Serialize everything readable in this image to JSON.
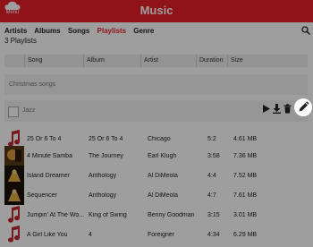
{
  "app": {
    "title": "Music",
    "menu_label": "Menu"
  },
  "tabs": [
    {
      "label": "Artists"
    },
    {
      "label": "Albums"
    },
    {
      "label": "Songs"
    },
    {
      "label": "Playlists",
      "active": true
    },
    {
      "label": "Genre"
    }
  ],
  "playlist_count": "3 Playlists",
  "columns": {
    "song": "Song",
    "album": "Album",
    "artist": "Artist",
    "duration": "Duration",
    "size": "Size"
  },
  "playlists": [
    {
      "name": "Christmas songs"
    },
    {
      "name": "Jazz",
      "actions": [
        "play-icon",
        "download-icon",
        "trash-icon",
        "pencil-icon"
      ]
    }
  ],
  "songs": [
    {
      "title": "25 Or 6 To 4",
      "album": "25 Or 6 To 4",
      "artist": "Chicago",
      "duration": "5:2",
      "size": "4.61 MB",
      "thumb": "music-note-icon"
    },
    {
      "title": "4 Minute Samba",
      "album": "The Journey",
      "artist": "Earl Klugh",
      "duration": "3:58",
      "size": "7.36 MB",
      "thumb": "album-art"
    },
    {
      "title": "Island Dreamer",
      "album": "Anthology",
      "artist": "Al DiMeola",
      "duration": "4:4",
      "size": "7.52 MB",
      "thumb": "album-art"
    },
    {
      "title": "Sequencer",
      "album": "Anthology",
      "artist": "Al DiMeola",
      "duration": "4:7",
      "size": "7.61 MB",
      "thumb": "album-art"
    },
    {
      "title": "Jumpin' At The Wo...",
      "album": "King of Swing",
      "artist": "Benny Goodman",
      "duration": "3:15",
      "size": "3.01 MB",
      "thumb": "music-note-icon"
    },
    {
      "title": "A Girl Like You",
      "album": "4",
      "artist": "Foreigner",
      "duration": "4:34",
      "size": "6.29 MB",
      "thumb": "music-note-icon"
    }
  ],
  "colors": {
    "brand": "#e8202a",
    "overlay": "rgba(0,0,0,0.38)"
  }
}
